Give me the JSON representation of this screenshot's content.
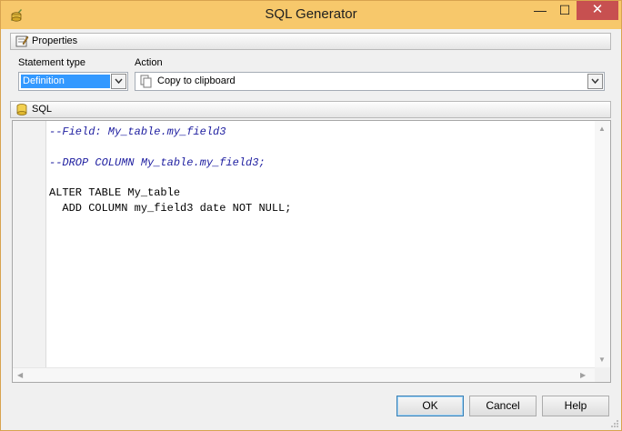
{
  "window": {
    "title": "SQL Generator",
    "minimize_glyph": "—",
    "maximize_glyph": "☐",
    "close_glyph": "✕"
  },
  "properties": {
    "label": "Properties",
    "icon": "properties-icon"
  },
  "statement_type": {
    "label": "Statement type",
    "value": "Definition"
  },
  "action": {
    "label": "Action",
    "value": "Copy to clipboard",
    "icon": "copy-icon"
  },
  "sql": {
    "label": "SQL",
    "icon": "database-icon",
    "lines": [
      "--Field: My_table.my_field3",
      "",
      "--DROP COLUMN My_table.my_field3;",
      "",
      "ALTER TABLE My_table",
      "  ADD COLUMN my_field3 date NOT NULL;"
    ]
  },
  "buttons": {
    "ok": "OK",
    "cancel": "Cancel",
    "help": "Help"
  },
  "colors": {
    "titlebar": "#f7c86b",
    "comment": "#1e1ea0",
    "selection": "#3399ff",
    "close": "#c75050"
  }
}
